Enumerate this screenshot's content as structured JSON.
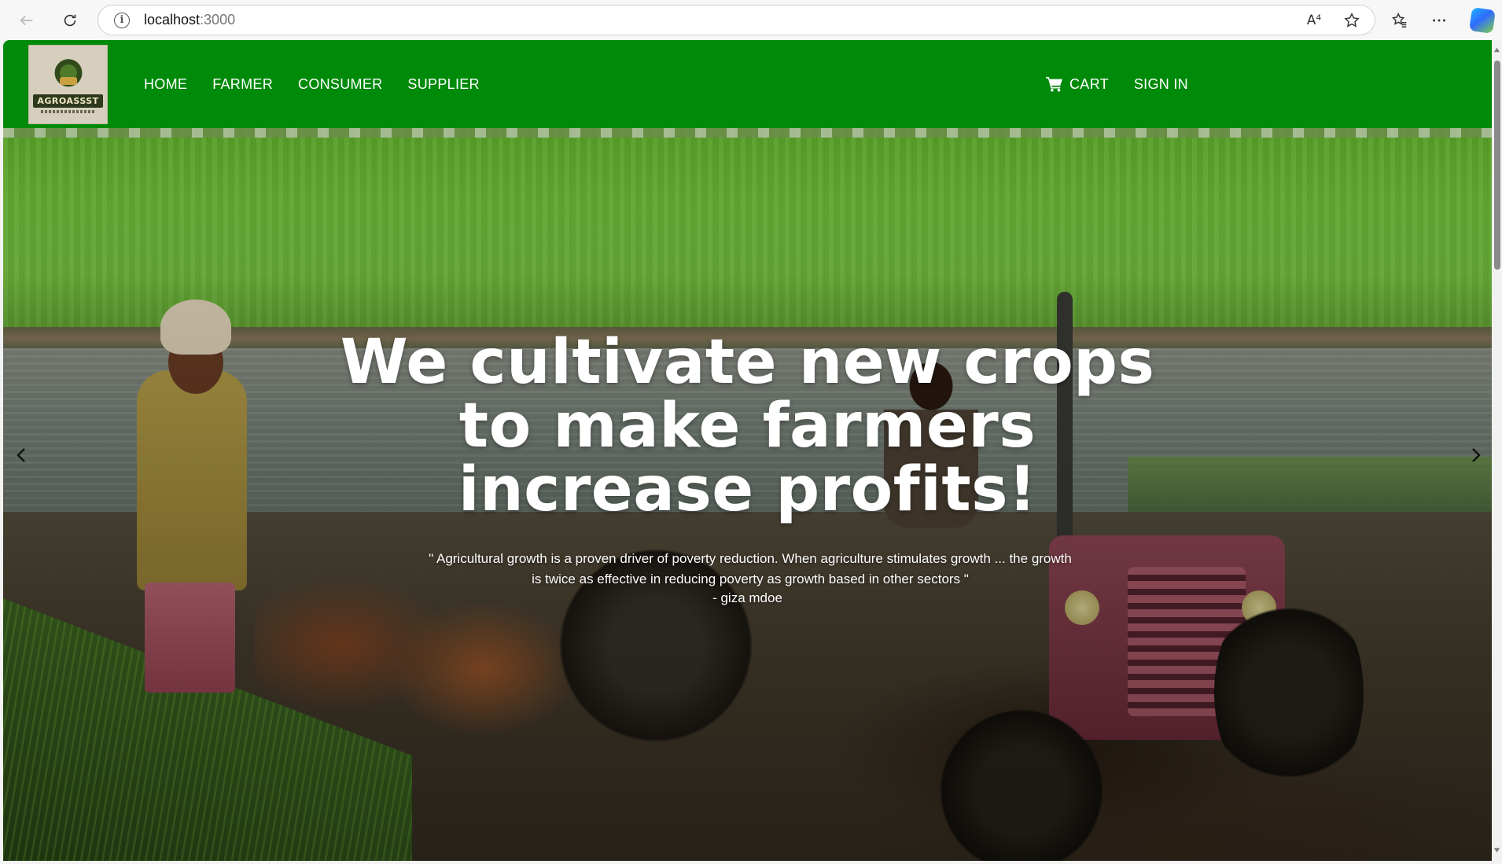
{
  "browser": {
    "url_host": "localhost",
    "url_port": ":3000",
    "read_aloud_label": "A⁴"
  },
  "navbar": {
    "logo_text": "AGROASSST",
    "links": [
      {
        "label": "HOME"
      },
      {
        "label": "FARMER"
      },
      {
        "label": "CONSUMER"
      },
      {
        "label": "SUPPLIER"
      }
    ],
    "cart_label": "CART",
    "signin_label": "SIGN IN",
    "background_color": "#008a0a"
  },
  "hero": {
    "title_lines": [
      "We cultivate new crops",
      "to make farmers",
      "increase profits!"
    ],
    "quote": "\" Agricultural growth is a proven driver of poverty reduction. When agriculture stimulates growth ... the growth is twice as effective in reducing poverty as growth based in other sectors \"",
    "author": "- giza mdoe"
  },
  "icons": {
    "back": "arrow-left-icon",
    "reload": "reload-icon",
    "info": "info-icon",
    "read_aloud": "read-aloud-icon",
    "favorite": "star-icon",
    "favorites": "favorites-icon",
    "more": "more-icon",
    "copilot": "copilot-icon",
    "cart": "cart-icon",
    "prev": "chevron-left-icon",
    "next": "chevron-right-icon"
  }
}
